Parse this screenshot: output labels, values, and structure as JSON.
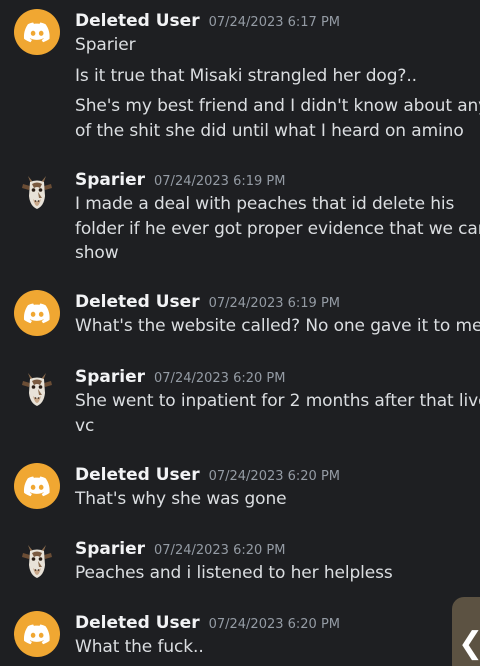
{
  "messages": [
    {
      "author": "Deleted User",
      "timestamp": "07/24/2023 6:17 PM",
      "avatar": "discord-logo",
      "lines": [
        "Sparier"
      ]
    },
    {
      "author": "",
      "timestamp": "",
      "avatar": "",
      "lines": [
        "Is it true that Misaki strangled her dog?.."
      ]
    },
    {
      "author": "",
      "timestamp": "",
      "avatar": "",
      "lines": [
        "She's my best friend and I didn't know about any",
        "of the shit she did until what I heard on amino"
      ]
    },
    {
      "author": "Sparier",
      "timestamp": "07/24/2023 6:19 PM",
      "avatar": "sparier-avatar",
      "lines": [
        "I made a deal with peaches that id delete his",
        "folder if he ever got proper evidence that we can",
        "show"
      ]
    },
    {
      "author": "Deleted User",
      "timestamp": "07/24/2023 6:19 PM",
      "avatar": "discord-logo",
      "lines": [
        "What's the website called? No one gave it to me"
      ]
    },
    {
      "author": "Sparier",
      "timestamp": "07/24/2023 6:20 PM",
      "avatar": "sparier-avatar",
      "lines": [
        "She went to inpatient for 2 months after that live",
        "vc"
      ]
    },
    {
      "author": "Deleted User",
      "timestamp": "07/24/2023 6:20 PM",
      "avatar": "discord-logo",
      "lines": [
        "That's why she was gone"
      ]
    },
    {
      "author": "Sparier",
      "timestamp": "07/24/2023 6:20 PM",
      "avatar": "sparier-avatar",
      "lines": [
        "Peaches and i listened to her helpless"
      ]
    },
    {
      "author": "Deleted User",
      "timestamp": "07/24/2023 6:20 PM",
      "avatar": "discord-logo",
      "lines": [
        "What the fuck.."
      ]
    }
  ],
  "side_tab": {
    "icon": "chevron-left-icon",
    "glyph": "❮"
  },
  "colors": {
    "background": "#1e1f22",
    "author": "#f2f3f5",
    "timestamp": "#949ba4",
    "text": "#dbdee1",
    "discord_avatar": "#f0a732"
  }
}
